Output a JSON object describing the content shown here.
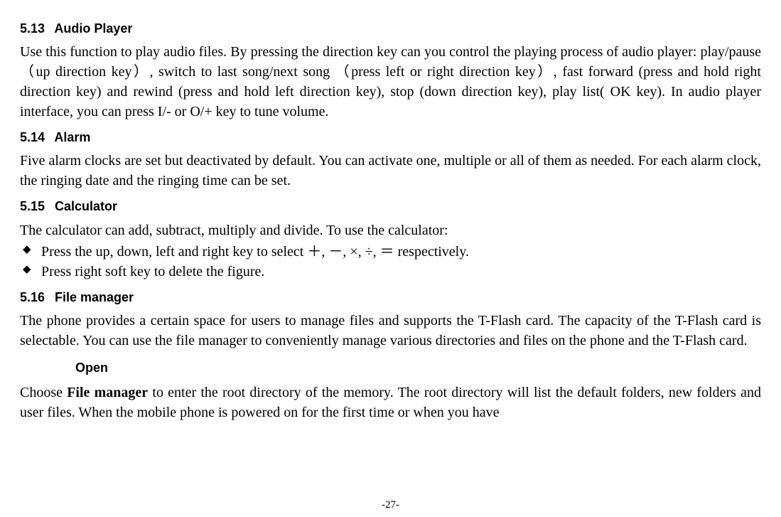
{
  "sections": {
    "audio": {
      "num": "5.13",
      "title": "Audio Player",
      "body": "Use this function to play audio files. By pressing the direction key can you control the playing process of audio player: play/pause（up direction key）, switch to last song/next song （press left or right direction key）, fast forward (press and hold right direction key) and rewind (press and hold left direction key), stop (down direction key), play list( OK key). In audio player interface, you can press I/- or O/+ key to tune volume."
    },
    "alarm": {
      "num": "5.14",
      "title": "Alarm",
      "body": "Five alarm clocks are set but deactivated by default. You can activate one, multiple or all of them as needed. For each alarm clock, the ringing date and the ringing time can be set."
    },
    "calc": {
      "num": "5.15",
      "title": "Calculator",
      "intro": "The calculator can add, subtract, multiply and divide. To use the calculator:",
      "bullets": [
        "Press the up, down, left and right key to select ＋, －, ×, ÷, ＝ respectively.",
        "Press right soft key to delete the figure."
      ]
    },
    "file": {
      "num": "5.16",
      "title": "File manager",
      "body": "The phone provides a certain space for users to manage files and supports the T-Flash card. The capacity of the T-Flash card is selectable. You can use the file manager to conveniently manage various directories and files on the phone and the T-Flash card.",
      "sub": {
        "title": "Open",
        "body_prefix": "Choose ",
        "body_bold": "File manager",
        "body_suffix": " to enter the root directory of the memory. The root directory will list the default folders, new folders and user files. When the mobile phone is powered on for the first time or when you have"
      }
    }
  },
  "page_number": "-27-"
}
